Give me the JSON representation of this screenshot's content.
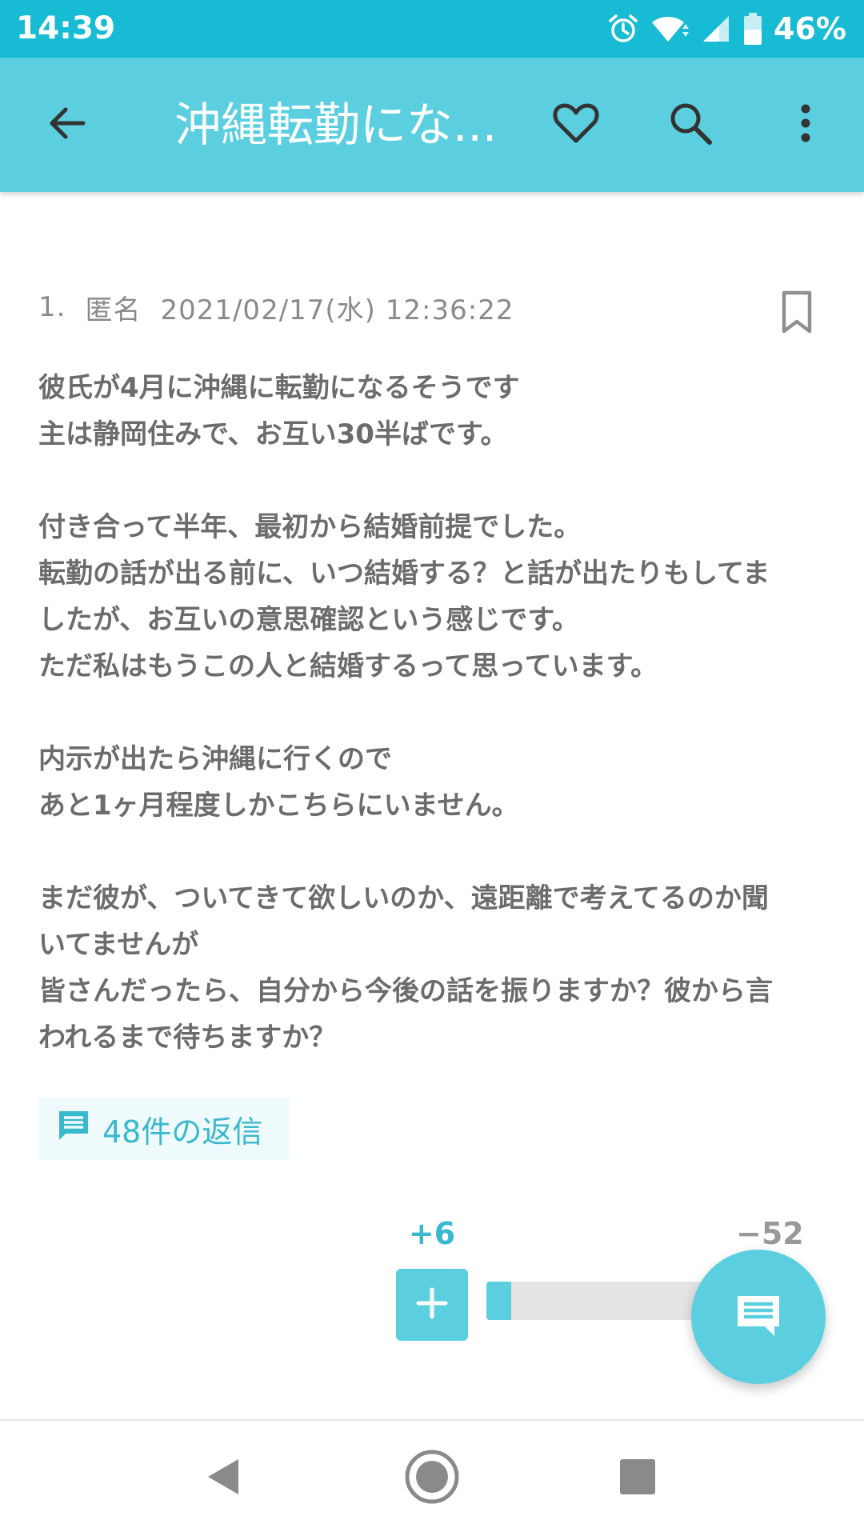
{
  "status_bar": {
    "time": "14:39",
    "battery": "46%"
  },
  "app_bar": {
    "title": "沖縄転勤にな..."
  },
  "post": {
    "number": "1.",
    "author": "匿名",
    "datetime": "2021/02/17(水) 12:36:22",
    "body": [
      [
        "彼氏が4月に沖縄に転勤になるそうです",
        "主は静岡住みで、お互い30半ばです。"
      ],
      [
        "付き合って半年、最初から結婚前提でした。",
        "転勤の話が出る前に、いつ結婚する？と話が出たりもしてま",
        "したが、お互いの意思確認という感じです。",
        "ただ私はもうこの人と結婚するって思っています。"
      ],
      [
        "内示が出たら沖縄に行くので",
        "あと1ヶ月程度しかこちらにいません。"
      ],
      [
        "まだ彼が、ついてきて欲しいのか、遠距離で考えてるのか聞",
        "いてませんが",
        "皆さんだったら、自分から今後の話を振りますか？彼から言",
        "われるまで待ちますか？"
      ]
    ]
  },
  "replies": {
    "label": "48件の返信"
  },
  "votes": {
    "plus": "+6",
    "minus": "−52",
    "plus_ratio": 0.103
  },
  "colors": {
    "status_bar": "#17bbd3",
    "app_bar": "#5bcfe0",
    "accent": "#3ab8cc"
  },
  "icons": {
    "back": "arrow-left-icon",
    "favorite": "heart-outline-icon",
    "search": "search-icon",
    "more": "more-vert-icon",
    "bookmark": "bookmark-outline-icon",
    "replies": "comment-icon",
    "fab": "comment-icon"
  }
}
